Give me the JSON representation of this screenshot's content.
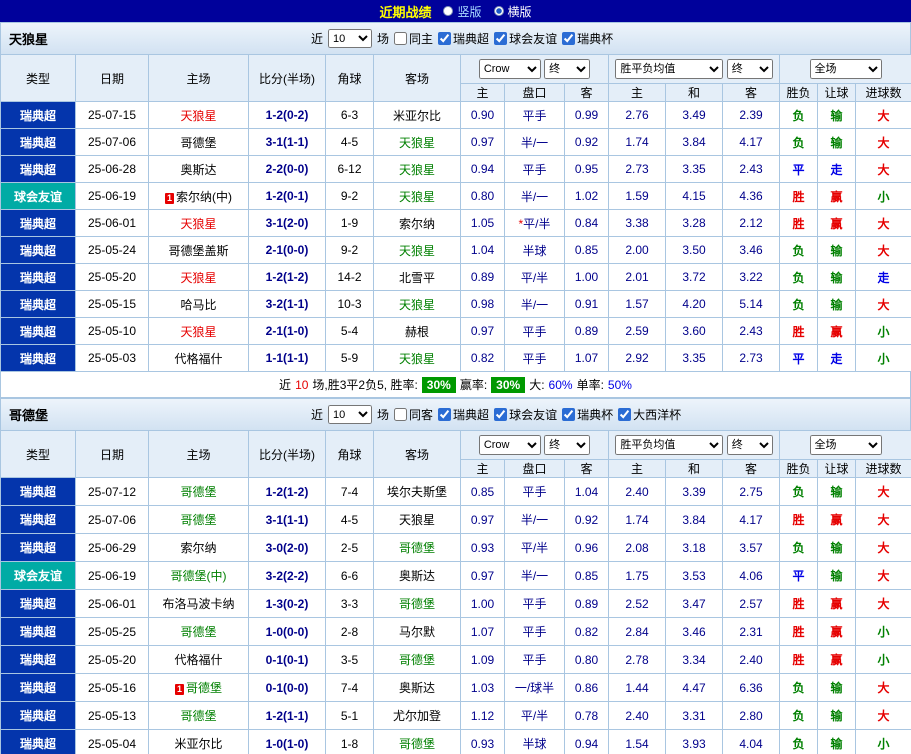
{
  "topbar": {
    "title": "近期战绩",
    "vertical_label": "竖版",
    "horizontal_label": "横版",
    "vertical_selected": false,
    "horizontal_selected": true
  },
  "controls": {
    "near": "近",
    "count": "10",
    "games": "场",
    "bookmaker": "Crow",
    "final_label": "终",
    "avg_label": "胜平负均值",
    "scope": "全场"
  },
  "headers": {
    "type": "类型",
    "date": "日期",
    "home": "主场",
    "score": "比分(半场)",
    "corner": "角球",
    "away": "客场",
    "h": "主",
    "line": "盘口",
    "a": "客",
    "h2": "主",
    "draw": "和",
    "a2": "客",
    "result": "胜负",
    "handicap": "让球",
    "goals": "进球数"
  },
  "colors": {
    "topbar_bg": "#00019B",
    "league_bg": "#0435AC",
    "friendly_bg": "#00ABA5",
    "win_red": "#E60000",
    "draw_blue": "#0000E6",
    "loss_green": "#008000",
    "odds_navy": "#00008B",
    "rate_badge_green": "#009900",
    "highlight_home_red": "#E60000",
    "highlight_away_green": "#008000"
  },
  "sections": [
    {
      "team": "天狼星",
      "filters": [
        {
          "label": "同主",
          "checked": false
        },
        {
          "label": "瑞典超",
          "checked": true
        },
        {
          "label": "球会友谊",
          "checked": true
        },
        {
          "label": "瑞典杯",
          "checked": true
        }
      ],
      "rows": [
        {
          "league": "瑞典超",
          "date": "25-07-15",
          "home": "天狼星",
          "hc": "red",
          "score": "1-2(0-2)",
          "corner": "6-3",
          "away": "米亚尔比",
          "ac": "",
          "o1": "0.90",
          "line": "平手",
          "o2": "0.99",
          "e1": "2.76",
          "e2": "3.49",
          "e3": "2.39",
          "res": "负",
          "han": "输",
          "goal": "大"
        },
        {
          "league": "瑞典超",
          "date": "25-07-06",
          "home": "哥德堡",
          "hc": "",
          "score": "3-1(1-1)",
          "corner": "4-5",
          "away": "天狼星",
          "ac": "green",
          "o1": "0.97",
          "line": "半/一",
          "o2": "0.92",
          "e1": "1.74",
          "e2": "3.84",
          "e3": "4.17",
          "res": "负",
          "han": "输",
          "goal": "大"
        },
        {
          "league": "瑞典超",
          "date": "25-06-28",
          "home": "奥斯达",
          "hc": "",
          "score": "2-2(0-0)",
          "corner": "6-12",
          "away": "天狼星",
          "ac": "green",
          "o1": "0.94",
          "line": "平手",
          "o2": "0.95",
          "e1": "2.73",
          "e2": "3.35",
          "e3": "2.43",
          "res": "平",
          "han": "走",
          "goal": "大"
        },
        {
          "league": "球会友谊",
          "date": "25-06-19",
          "home": "索尔纳(中)",
          "hb": "1",
          "hc": "",
          "score": "1-2(0-1)",
          "corner": "9-2",
          "away": "天狼星",
          "ac": "green",
          "o1": "0.80",
          "line": "半/一",
          "o2": "1.02",
          "e1": "1.59",
          "e2": "4.15",
          "e3": "4.36",
          "res": "胜",
          "han": "赢",
          "goal": "小"
        },
        {
          "league": "瑞典超",
          "date": "25-06-01",
          "home": "天狼星",
          "hc": "red",
          "score": "3-1(2-0)",
          "corner": "1-9",
          "away": "索尔纳",
          "ac": "",
          "o1": "1.05",
          "line": "*平/半",
          "o2": "0.84",
          "e1": "3.38",
          "e2": "3.28",
          "e3": "2.12",
          "res": "胜",
          "han": "赢",
          "goal": "大"
        },
        {
          "league": "瑞典超",
          "date": "25-05-24",
          "home": "哥德堡盖斯",
          "hc": "",
          "score": "2-1(0-0)",
          "corner": "9-2",
          "away": "天狼星",
          "ac": "green",
          "o1": "1.04",
          "line": "半球",
          "o2": "0.85",
          "e1": "2.00",
          "e2": "3.50",
          "e3": "3.46",
          "res": "负",
          "han": "输",
          "goal": "大"
        },
        {
          "league": "瑞典超",
          "date": "25-05-20",
          "home": "天狼星",
          "hc": "red",
          "score": "1-2(1-2)",
          "corner": "14-2",
          "away": "北雪平",
          "ac": "",
          "o1": "0.89",
          "line": "平/半",
          "o2": "1.00",
          "e1": "2.01",
          "e2": "3.72",
          "e3": "3.22",
          "res": "负",
          "han": "输",
          "goal": "走"
        },
        {
          "league": "瑞典超",
          "date": "25-05-15",
          "home": "哈马比",
          "hc": "",
          "score": "3-2(1-1)",
          "corner": "10-3",
          "away": "天狼星",
          "ac": "green",
          "o1": "0.98",
          "line": "半/一",
          "o2": "0.91",
          "e1": "1.57",
          "e2": "4.20",
          "e3": "5.14",
          "res": "负",
          "han": "输",
          "goal": "大"
        },
        {
          "league": "瑞典超",
          "date": "25-05-10",
          "home": "天狼星",
          "hc": "red",
          "score": "2-1(1-0)",
          "corner": "5-4",
          "away": "赫根",
          "ac": "",
          "o1": "0.97",
          "line": "平手",
          "o2": "0.89",
          "e1": "2.59",
          "e2": "3.60",
          "e3": "2.43",
          "res": "胜",
          "han": "赢",
          "goal": "小"
        },
        {
          "league": "瑞典超",
          "date": "25-05-03",
          "home": "代格福什",
          "hc": "",
          "score": "1-1(1-1)",
          "corner": "5-9",
          "away": "天狼星",
          "ac": "green",
          "o1": "0.82",
          "line": "平手",
          "o2": "1.07",
          "e1": "2.92",
          "e2": "3.35",
          "e3": "2.73",
          "res": "平",
          "han": "走",
          "goal": "小"
        }
      ],
      "summary": {
        "p1": "近",
        "p2": "10",
        "p3": "场,胜3平2负5, 胜率:",
        "b1": "30%",
        "p4": "赢率:",
        "b2": "30%",
        "p5": "大:",
        "p6": "60%",
        "p7": "单率:",
        "p8": "50%"
      }
    },
    {
      "team": "哥德堡",
      "filters": [
        {
          "label": "同客",
          "checked": false
        },
        {
          "label": "瑞典超",
          "checked": true
        },
        {
          "label": "球会友谊",
          "checked": true
        },
        {
          "label": "瑞典杯",
          "checked": true
        },
        {
          "label": "大西洋杯",
          "checked": true
        }
      ],
      "rows": [
        {
          "league": "瑞典超",
          "date": "25-07-12",
          "home": "哥德堡",
          "hc": "green",
          "score": "1-2(1-2)",
          "corner": "7-4",
          "away": "埃尔夫斯堡",
          "ac": "",
          "o1": "0.85",
          "line": "平手",
          "o2": "1.04",
          "e1": "2.40",
          "e2": "3.39",
          "e3": "2.75",
          "res": "负",
          "han": "输",
          "goal": "大"
        },
        {
          "league": "瑞典超",
          "date": "25-07-06",
          "home": "哥德堡",
          "hc": "green",
          "score": "3-1(1-1)",
          "corner": "4-5",
          "away": "天狼星",
          "ac": "",
          "o1": "0.97",
          "line": "半/一",
          "o2": "0.92",
          "e1": "1.74",
          "e2": "3.84",
          "e3": "4.17",
          "res": "胜",
          "han": "赢",
          "goal": "大"
        },
        {
          "league": "瑞典超",
          "date": "25-06-29",
          "home": "索尔纳",
          "hc": "",
          "score": "3-0(2-0)",
          "corner": "2-5",
          "away": "哥德堡",
          "ac": "green",
          "o1": "0.93",
          "line": "平/半",
          "o2": "0.96",
          "e1": "2.08",
          "e2": "3.18",
          "e3": "3.57",
          "res": "负",
          "han": "输",
          "goal": "大"
        },
        {
          "league": "球会友谊",
          "date": "25-06-19",
          "home": "哥德堡(中)",
          "hc": "green",
          "score": "3-2(2-2)",
          "corner": "6-6",
          "away": "奥斯达",
          "ac": "",
          "o1": "0.97",
          "line": "半/一",
          "o2": "0.85",
          "e1": "1.75",
          "e2": "3.53",
          "e3": "4.06",
          "res": "平",
          "han": "输",
          "goal": "大"
        },
        {
          "league": "瑞典超",
          "date": "25-06-01",
          "home": "布洛马波卡纳",
          "hc": "",
          "score": "1-3(0-2)",
          "corner": "3-3",
          "away": "哥德堡",
          "ac": "green",
          "o1": "1.00",
          "line": "平手",
          "o2": "0.89",
          "e1": "2.52",
          "e2": "3.47",
          "e3": "2.57",
          "res": "胜",
          "han": "赢",
          "goal": "大"
        },
        {
          "league": "瑞典超",
          "date": "25-05-25",
          "home": "哥德堡",
          "hc": "green",
          "score": "1-0(0-0)",
          "corner": "2-8",
          "away": "马尔默",
          "ac": "",
          "o1": "1.07",
          "line": "平手",
          "o2": "0.82",
          "e1": "2.84",
          "e2": "3.46",
          "e3": "2.31",
          "res": "胜",
          "han": "赢",
          "goal": "小"
        },
        {
          "league": "瑞典超",
          "date": "25-05-20",
          "home": "代格福什",
          "hc": "",
          "score": "0-1(0-1)",
          "corner": "3-5",
          "away": "哥德堡",
          "ac": "green",
          "o1": "1.09",
          "line": "平手",
          "o2": "0.80",
          "e1": "2.78",
          "e2": "3.34",
          "e3": "2.40",
          "res": "胜",
          "han": "赢",
          "goal": "小"
        },
        {
          "league": "瑞典超",
          "date": "25-05-16",
          "home": "哥德堡",
          "hb": "1",
          "hc": "green",
          "score": "0-1(0-0)",
          "corner": "7-4",
          "away": "奥斯达",
          "ac": "",
          "o1": "1.03",
          "line": "一/球半",
          "o2": "0.86",
          "e1": "1.44",
          "e2": "4.47",
          "e3": "6.36",
          "res": "负",
          "han": "输",
          "goal": "大"
        },
        {
          "league": "瑞典超",
          "date": "25-05-13",
          "home": "哥德堡",
          "hc": "green",
          "score": "1-2(1-1)",
          "corner": "5-1",
          "away": "尤尔加登",
          "ac": "",
          "o1": "1.12",
          "line": "平/半",
          "o2": "0.78",
          "e1": "2.40",
          "e2": "3.31",
          "e3": "2.80",
          "res": "负",
          "han": "输",
          "goal": "大"
        },
        {
          "league": "瑞典超",
          "date": "25-05-04",
          "home": "米亚尔比",
          "hc": "",
          "score": "1-0(1-0)",
          "corner": "1-8",
          "away": "哥德堡",
          "ac": "green",
          "o1": "0.93",
          "line": "半球",
          "o2": "0.94",
          "e1": "1.54",
          "e2": "3.93",
          "e3": "4.04",
          "res": "负",
          "han": "输",
          "goal": "小"
        }
      ]
    }
  ]
}
